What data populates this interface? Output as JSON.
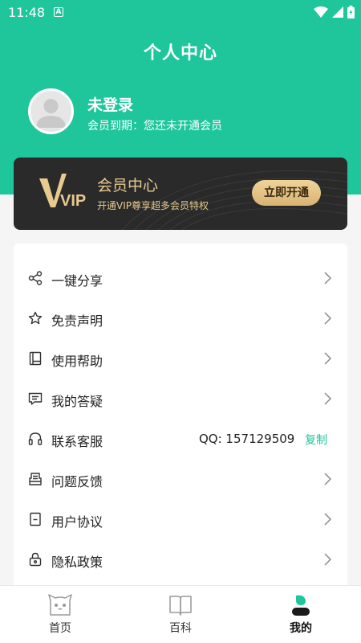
{
  "status_bar": {
    "time": "11:48",
    "indicator": "A"
  },
  "header": {
    "title": "个人中心"
  },
  "user": {
    "name": "未登录",
    "membership": "会员到期：您还未开通会员"
  },
  "vip": {
    "logo_text": "VIP",
    "title": "会员中心",
    "description": "开通VIP尊享超多会员特权",
    "button_label": "立即开通"
  },
  "menu": {
    "items": [
      {
        "label": "一键分享",
        "icon": "share-icon"
      },
      {
        "label": "免责声明",
        "icon": "star-icon"
      },
      {
        "label": "使用帮助",
        "icon": "book-icon"
      },
      {
        "label": "我的答疑",
        "icon": "chat-icon"
      },
      {
        "label": "联系客服",
        "icon": "headset-icon",
        "value": "QQ: 157129509",
        "action": "复制"
      },
      {
        "label": "问题反馈",
        "icon": "feedback-icon"
      },
      {
        "label": "用户协议",
        "icon": "document-icon"
      },
      {
        "label": "隐私政策",
        "icon": "lock-icon"
      }
    ]
  },
  "tabs": [
    {
      "label": "首页",
      "icon": "cat-icon",
      "active": false
    },
    {
      "label": "百科",
      "icon": "open-book-icon",
      "active": false
    },
    {
      "label": "我的",
      "icon": "profile-icon",
      "active": true
    }
  ],
  "colors": {
    "accent": "#1fc69b",
    "vip_gold": "#e8c98e",
    "vip_bg": "#2a2a2a"
  }
}
